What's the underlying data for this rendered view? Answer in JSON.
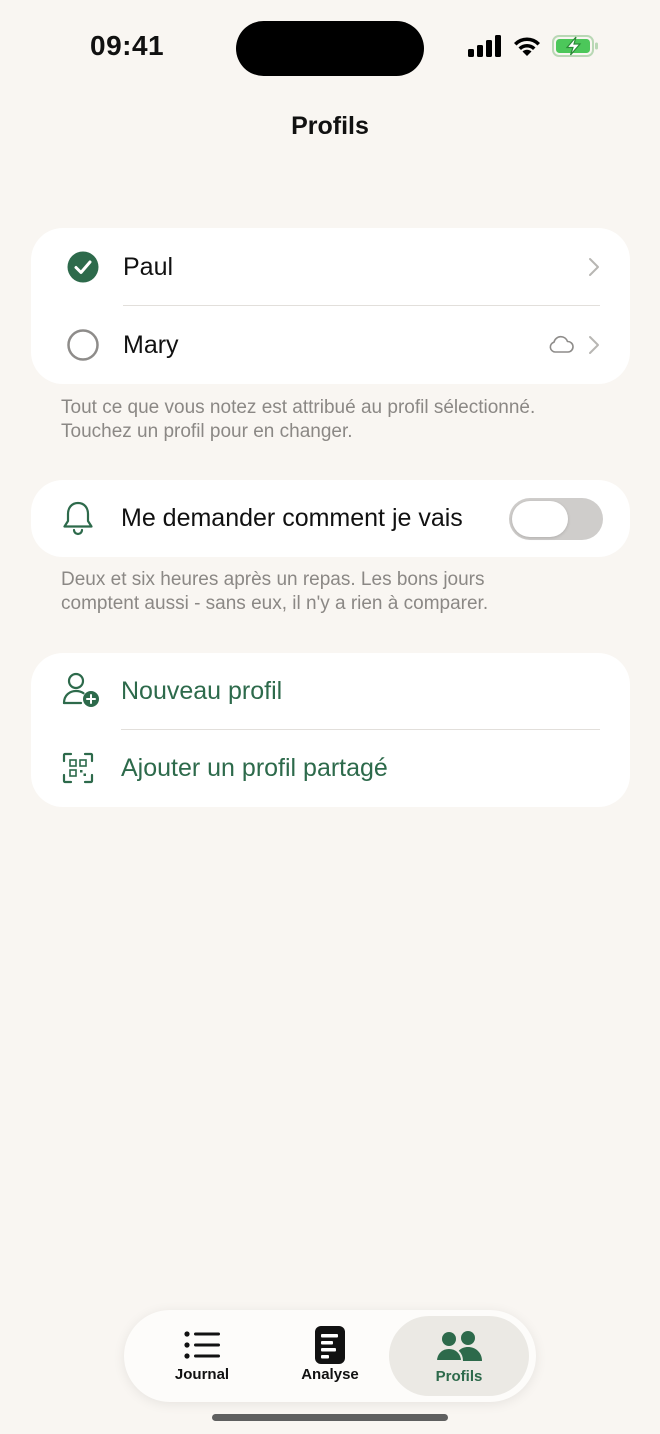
{
  "status_bar": {
    "time": "09:41"
  },
  "nav": {
    "title": "Profils"
  },
  "profiles": [
    {
      "name": "Paul",
      "selected": true
    },
    {
      "name": "Mary",
      "selected": false,
      "cloud": true
    }
  ],
  "profiles_footnote_1": "Tout ce que vous notez est attribué au profil sélectionné.",
  "profiles_footnote_2": "Touchez un profil pour en changer.",
  "reminder": {
    "label": "Me demander comment je vais",
    "enabled": false
  },
  "reminder_footnote_1": "Deux et six heures après un repas. Les bons jours",
  "reminder_footnote_2": "comptent aussi - sans eux, il n'y a rien à comparer.",
  "actions": {
    "new_profile": "Nouveau profil",
    "add_shared": "Ajouter un profil partagé"
  },
  "tabs": [
    {
      "label": "Journal",
      "icon": "list-icon"
    },
    {
      "label": "Analyse",
      "icon": "document-icon"
    },
    {
      "label": "Profils",
      "icon": "people-icon",
      "active": true
    }
  ],
  "colors": {
    "accent": "#2d6a4b",
    "background": "#f9f6f2"
  }
}
